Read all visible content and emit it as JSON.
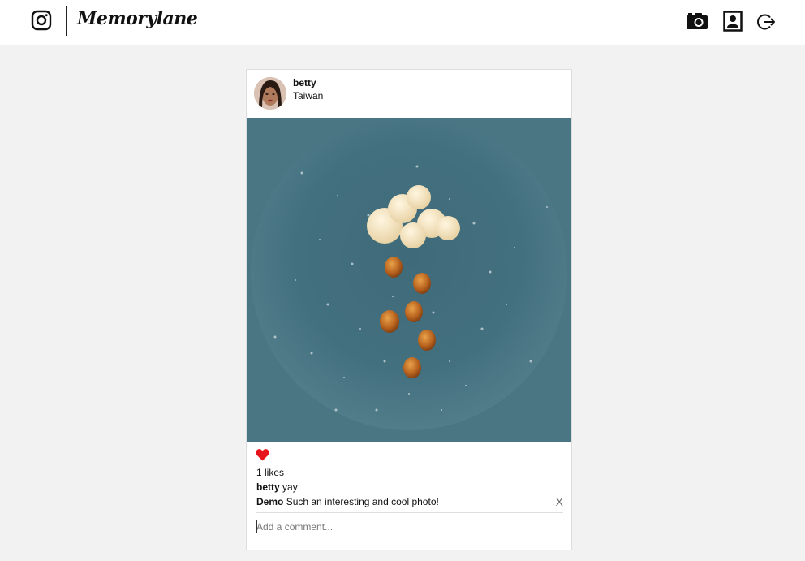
{
  "brand": {
    "name": "Memorylane"
  },
  "nav": {
    "camera_icon": "camera-icon",
    "profile_icon": "profile-icon",
    "logout_icon": "logout-icon"
  },
  "post": {
    "username": "betty",
    "location": "Taiwan",
    "likes_text": "1 likes",
    "caption": {
      "user": "betty",
      "text": "yay"
    },
    "comments": [
      {
        "user": "Demo",
        "text": "Such an interesting and cool photo!",
        "delete_label": "X"
      }
    ],
    "comment_placeholder": "Add a comment..."
  },
  "colors": {
    "heart": "#e8141b",
    "photo_background": "#4b7382"
  }
}
